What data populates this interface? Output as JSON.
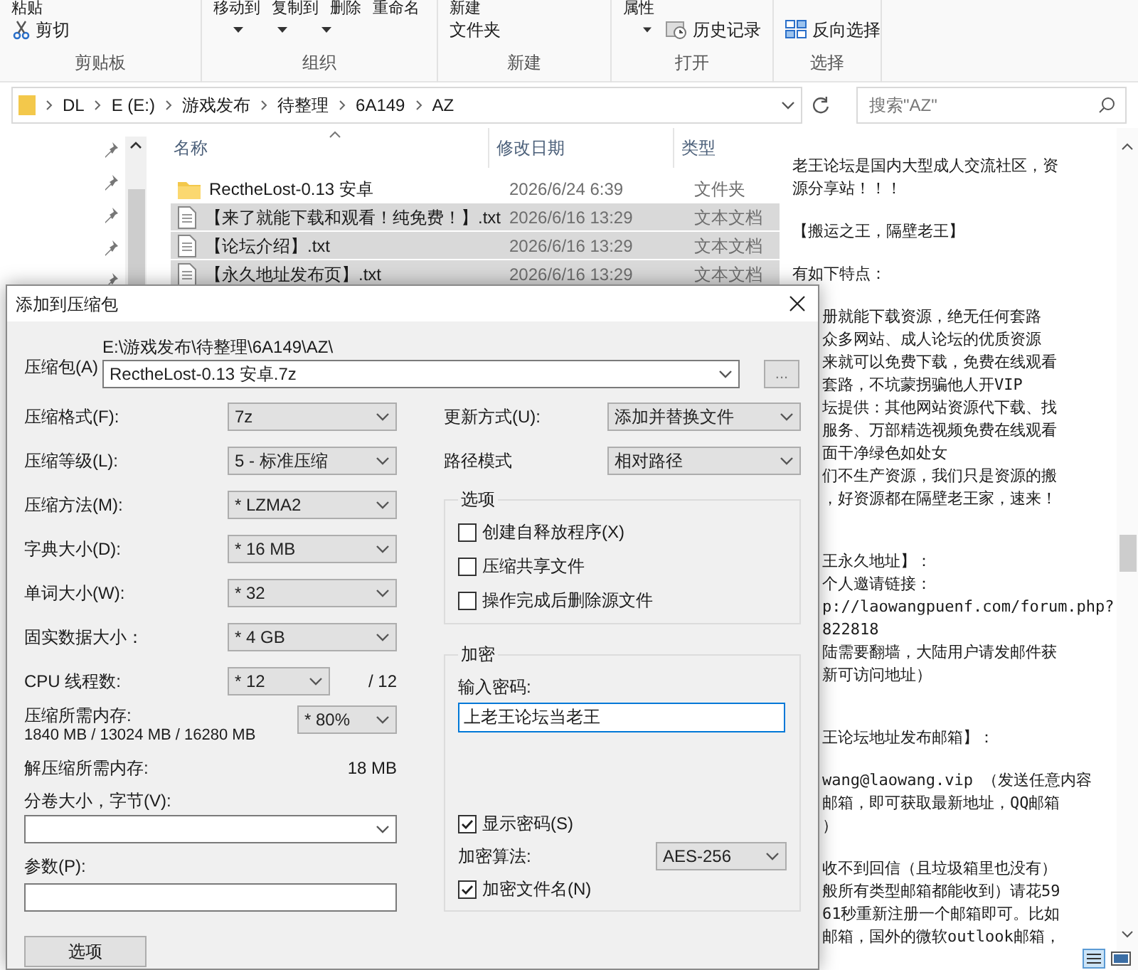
{
  "ribbon": {
    "groups": [
      {
        "label": "剪贴板",
        "top": [
          "粘贴"
        ],
        "items": [
          "剪切"
        ]
      },
      {
        "label": "组织",
        "top": [
          "移动到",
          "复制到",
          "删除",
          "重命名"
        ]
      },
      {
        "label": "新建",
        "top": [
          "新建"
        ],
        "items": [
          "文件夹"
        ]
      },
      {
        "label": "打开",
        "top": [
          "属性"
        ],
        "items": [
          "历史记录"
        ]
      },
      {
        "label": "选择",
        "items": [
          "反向选择"
        ]
      }
    ]
  },
  "address": {
    "breadcrumbs": [
      "DL",
      "E (E:)",
      "游戏发布",
      "待整理",
      "6A149",
      "AZ"
    ],
    "search_placeholder": "搜索\"AZ\""
  },
  "files": {
    "columns": [
      "名称",
      "修改日期",
      "类型"
    ],
    "rows": [
      {
        "name": "RectheLost-0.13 安卓",
        "date": "2026/6/24 6:39",
        "type": "文件夹",
        "kind": "folder",
        "selected": false
      },
      {
        "name": "【来了就能下载和观看！纯免费！】.txt",
        "date": "2026/6/16 13:29",
        "type": "文本文档",
        "kind": "text",
        "selected": true
      },
      {
        "name": "【论坛介绍】.txt",
        "date": "2026/6/16 13:29",
        "type": "文本文档",
        "kind": "text",
        "selected": true
      },
      {
        "name": "【永久地址发布页】.txt",
        "date": "2026/6/16 13:29",
        "type": "文本文档",
        "kind": "text",
        "selected": true
      }
    ]
  },
  "preview": {
    "paragraphs": [
      {
        "kind": "top",
        "lines": [
          {
            "text": "老王论坛是国内大型成人交流社区，资",
            "kind": "full"
          },
          {
            "text": "源分享站！！！",
            "kind": "full"
          }
        ]
      },
      {
        "kind": "near",
        "lines": [
          {
            "text": "【搬运之王，隔壁老王】",
            "kind": "full"
          }
        ]
      },
      {
        "kind": "near",
        "lines": [
          {
            "text": "有如下特点：",
            "kind": "full"
          }
        ]
      },
      {
        "kind": "near",
        "lines": [
          {
            "text": "册就能下载资源，绝无任何套路",
            "kind": "cut"
          },
          {
            "text": "众多网站、成人论坛的优质资源",
            "kind": "cut"
          },
          {
            "text": "来就可以免费下载，免费在线观看",
            "kind": "cut"
          },
          {
            "text": "套路，不坑蒙拐骗他人开VIP",
            "kind": "cut"
          },
          {
            "text": "坛提供：其他网站资源代下载、找",
            "kind": "cut"
          },
          {
            "text": "服务、万部精选视频免费在线观看",
            "kind": "cut"
          },
          {
            "text": "面干净绿色如处女",
            "kind": "cut"
          },
          {
            "text": "们不生产资源，我们只是资源的搬",
            "kind": "cut"
          },
          {
            "text": "，好资源都在隔壁老王家，速来！",
            "kind": "cut"
          }
        ]
      },
      {
        "kind": "far",
        "lines": [
          {
            "text": "王永久地址】：",
            "kind": "cut"
          },
          {
            "text": "个人邀请链接：",
            "kind": "cut"
          },
          {
            "text": "p://laowangpuenf.com/forum.php?",
            "kind": "cut"
          },
          {
            "text": "822818",
            "kind": "cut"
          },
          {
            "text": "陆需要翻墙，大陆用户请发邮件获",
            "kind": "cut"
          },
          {
            "text": "新可访问地址）",
            "kind": "cut"
          }
        ]
      },
      {
        "kind": "far",
        "lines": [
          {
            "text": "王论坛地址发布邮箱】：",
            "kind": "cut"
          }
        ]
      },
      {
        "kind": "near",
        "lines": [
          {
            "text": "wang@laowang.vip  （发送任意内容",
            "kind": "cut"
          },
          {
            "text": "邮箱，即可获取最新地址，QQ邮箱",
            "kind": "cut"
          },
          {
            "text": "）",
            "kind": "cut"
          }
        ]
      },
      {
        "kind": "near",
        "lines": [
          {
            "text": "收不到回信（且垃圾箱里也没有）",
            "kind": "cut"
          },
          {
            "text": "般所有类型邮箱都能收到）请花59",
            "kind": "cut"
          },
          {
            "text": "61秒重新注册一个邮箱即可。比如",
            "kind": "cut"
          },
          {
            "text": "邮箱，国外的微软outlook邮箱，",
            "kind": "cut"
          }
        ]
      }
    ]
  },
  "dialog": {
    "title": "添加到压缩包",
    "archive": {
      "label": "压缩包(A)",
      "path": "E:\\游戏发布\\待整理\\6A149\\AZ\\",
      "name": "RectheLost-0.13 安卓.7z",
      "browse": "..."
    },
    "settings": [
      {
        "label": "压缩格式(F):",
        "value": "7z"
      },
      {
        "label": "压缩等级(L):",
        "value": "5 - 标准压缩"
      },
      {
        "label": "压缩方法(M):",
        "value": "* LZMA2"
      },
      {
        "label": "字典大小(D):",
        "value": "* 16 MB"
      },
      {
        "label": "单词大小(W):",
        "value": "* 32"
      },
      {
        "label": "固实数据大小：",
        "value": "* 4 GB"
      }
    ],
    "cpu": {
      "label": "CPU 线程数:",
      "value": "* 12",
      "max": "/ 12"
    },
    "memory": {
      "label": "压缩所需内存:",
      "detail": "1840 MB / 13024 MB / 16280 MB",
      "value": "* 80%"
    },
    "decompress": {
      "label": "解压缩所需内存:",
      "value": "18 MB"
    },
    "volume": {
      "label": "分卷大小，字节(V):"
    },
    "params": {
      "label": "参数(P):"
    },
    "options_button": "选项",
    "update": {
      "label": "更新方式(U):",
      "value": "添加并替换文件"
    },
    "path_mode": {
      "label": "路径模式",
      "value": "相对路径"
    },
    "options": {
      "title": "选项",
      "checkboxes": [
        {
          "label": "创建自释放程序(X)",
          "checked": false
        },
        {
          "label": "压缩共享文件",
          "checked": false
        },
        {
          "label": "操作完成后删除源文件",
          "checked": false
        }
      ]
    },
    "encryption": {
      "title": "加密",
      "password_label": "输入密码:",
      "password": "上老王论坛当老王",
      "focused": true,
      "show_password": {
        "label": "显示密码(S)",
        "checked": true
      },
      "method_label": "加密算法:",
      "method": "AES-256",
      "encrypt_names": {
        "label": "加密文件名(N)",
        "checked": true
      }
    }
  }
}
